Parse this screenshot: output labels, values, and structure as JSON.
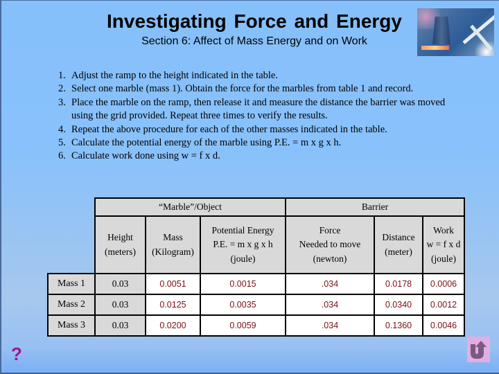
{
  "header": {
    "title": "Investigating  Force and  Energy",
    "subtitle": "Section 6:  Affect of Mass Energy and on Work"
  },
  "steps": [
    {
      "num": "1.",
      "text": "Adjust the ramp to the height indicated in the table."
    },
    {
      "num": "2.",
      "text": "Select one marble (mass 1). Obtain the force for the marbles from table 1 and record."
    },
    {
      "num": "3.",
      "text": "Place the marble on the ramp, then release it and measure the distance the barrier was moved using the grid provided. Repeat three times to verify the results."
    },
    {
      "num": "4.",
      "text": "Repeat the above procedure for each of the other masses indicated in the table."
    },
    {
      "num": "5.",
      "text": "Calculate the potential energy of the marble using P.E. = m x g x h."
    },
    {
      "num": "6.",
      "text": "Calculate work done using w = f  x  d."
    }
  ],
  "table": {
    "group_headers": [
      "“Marble”/Object",
      "Barrier"
    ],
    "columns": [
      {
        "line1": "Height",
        "line2": "(meters)",
        "line3": ""
      },
      {
        "line1": "Mass",
        "line2": "(Kilogram)",
        "line3": ""
      },
      {
        "line1": "Potential Energy",
        "line2": "P.E. = m x g x h",
        "line3": "(joule)"
      },
      {
        "line1": "Force",
        "line2": "Needed to move",
        "line3": "(newton)"
      },
      {
        "line1": "Distance",
        "line2": "(meter)",
        "line3": ""
      },
      {
        "line1": "Work",
        "line2": "w = f  x  d",
        "line3": "(joule)"
      }
    ],
    "rows": [
      {
        "label": "Mass 1",
        "height": "0.03",
        "mass": "0.0051",
        "pe": "0.0015",
        "force": ".034",
        "distance": "0.0178",
        "work": "0.0006"
      },
      {
        "label": "Mass 2",
        "height": "0.03",
        "mass": "0.0125",
        "pe": "0.0035",
        "force": ".034",
        "distance": "0.0340",
        "work": "0.0012"
      },
      {
        "label": "Mass 3",
        "height": "0.03",
        "mass": "0.0200",
        "pe": "0.0059",
        "force": ".034",
        "distance": "0.1360",
        "work": "0.0046"
      }
    ]
  },
  "footer": {
    "help_label": "?",
    "back_icon": "u-turn-arrow-icon"
  },
  "colors": {
    "value_text": "#7a0f14",
    "help": "#a0148c",
    "back_button_bg": "#e2aee2",
    "back_button_glyph": "#7a5a80"
  }
}
